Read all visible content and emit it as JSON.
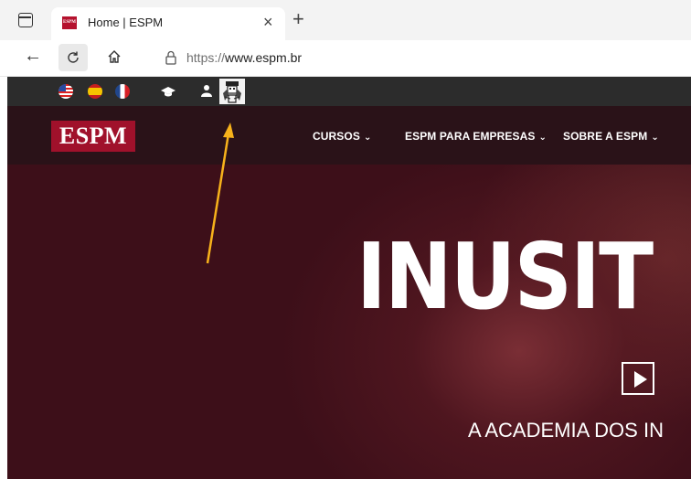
{
  "browser": {
    "tab": {
      "favicon_text": "ESPM",
      "title": "Home | ESPM",
      "close_glyph": "×"
    },
    "new_tab_glyph": "+",
    "url_scheme": "https://",
    "url_host": "www.espm.br",
    "icons": [
      "tab-actions-icon",
      "back-icon",
      "reload-icon",
      "home-icon",
      "lock-icon"
    ]
  },
  "site": {
    "topbar": {
      "languages": [
        "flag-us-icon",
        "flag-es-icon",
        "flag-fr-icon"
      ],
      "icons": [
        "graduation-cap-icon",
        "user-icon",
        "vlibras-icon"
      ]
    },
    "logo": "ESPM",
    "menu": [
      {
        "label": "CURSOS"
      },
      {
        "label": "ESPM PARA EMPRESAS"
      },
      {
        "label": "SOBRE A ESPM"
      }
    ],
    "menu_chevron": "⌄",
    "hero": {
      "title": "INUSIT",
      "subtitle": "A ACADEMIA DOS IN"
    }
  },
  "colors": {
    "brand_red": "#a0112b",
    "hero_bg": "#3d0f19",
    "annotation_arrow": "#f7b21b"
  }
}
